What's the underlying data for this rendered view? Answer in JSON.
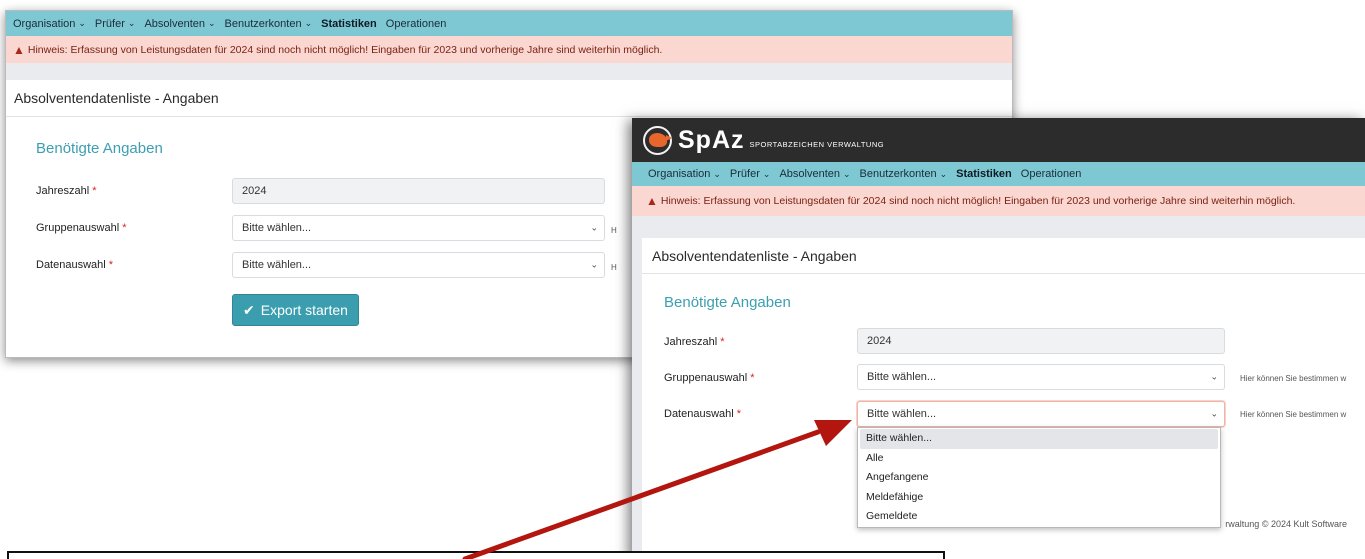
{
  "nav": {
    "items": [
      {
        "label": "Organisation",
        "dropdown": true
      },
      {
        "label": "Prüfer",
        "dropdown": true
      },
      {
        "label": "Absolventen",
        "dropdown": true
      },
      {
        "label": "Benutzerkonten",
        "dropdown": true
      },
      {
        "label": "Statistiken",
        "dropdown": false,
        "active": true
      },
      {
        "label": "Operationen",
        "dropdown": false
      }
    ]
  },
  "alert": {
    "text": "Hinweis: Erfassung von Leistungsdaten für 2024 sind noch nicht möglich! Eingaben für 2023 und vorherige Jahre sind weiterhin möglich."
  },
  "page": {
    "title": "Absolventendatenliste - Angaben",
    "section_title": "Benötigte Angaben"
  },
  "form": {
    "year_label": "Jahreszahl",
    "year_value": "2024",
    "group_label": "Gruppenauswahl",
    "group_value": "Bitte wählen...",
    "data_label": "Datenauswahl",
    "data_value": "Bitte wählen...",
    "required_marker": "*",
    "hint_text": "Hier können Sie bestimmen w",
    "back_hint_fragment": "H",
    "export_label": "Export starten"
  },
  "logo": {
    "main": "SpAz",
    "sub": "Sportabzeichen Verwaltung"
  },
  "dropdown": {
    "options": [
      "Bitte wählen...",
      "Alle",
      "Angefangene",
      "Meldefähige",
      "Gemeldete"
    ],
    "selected_index": 0
  },
  "footer": {
    "text": "rwaltung © 2024 Kult Software"
  },
  "colors": {
    "navbar": "#7ec8d3",
    "alert_bg": "#fad7d0",
    "accent": "#3a9eaf",
    "annotation_arrow": "#b3160f"
  }
}
